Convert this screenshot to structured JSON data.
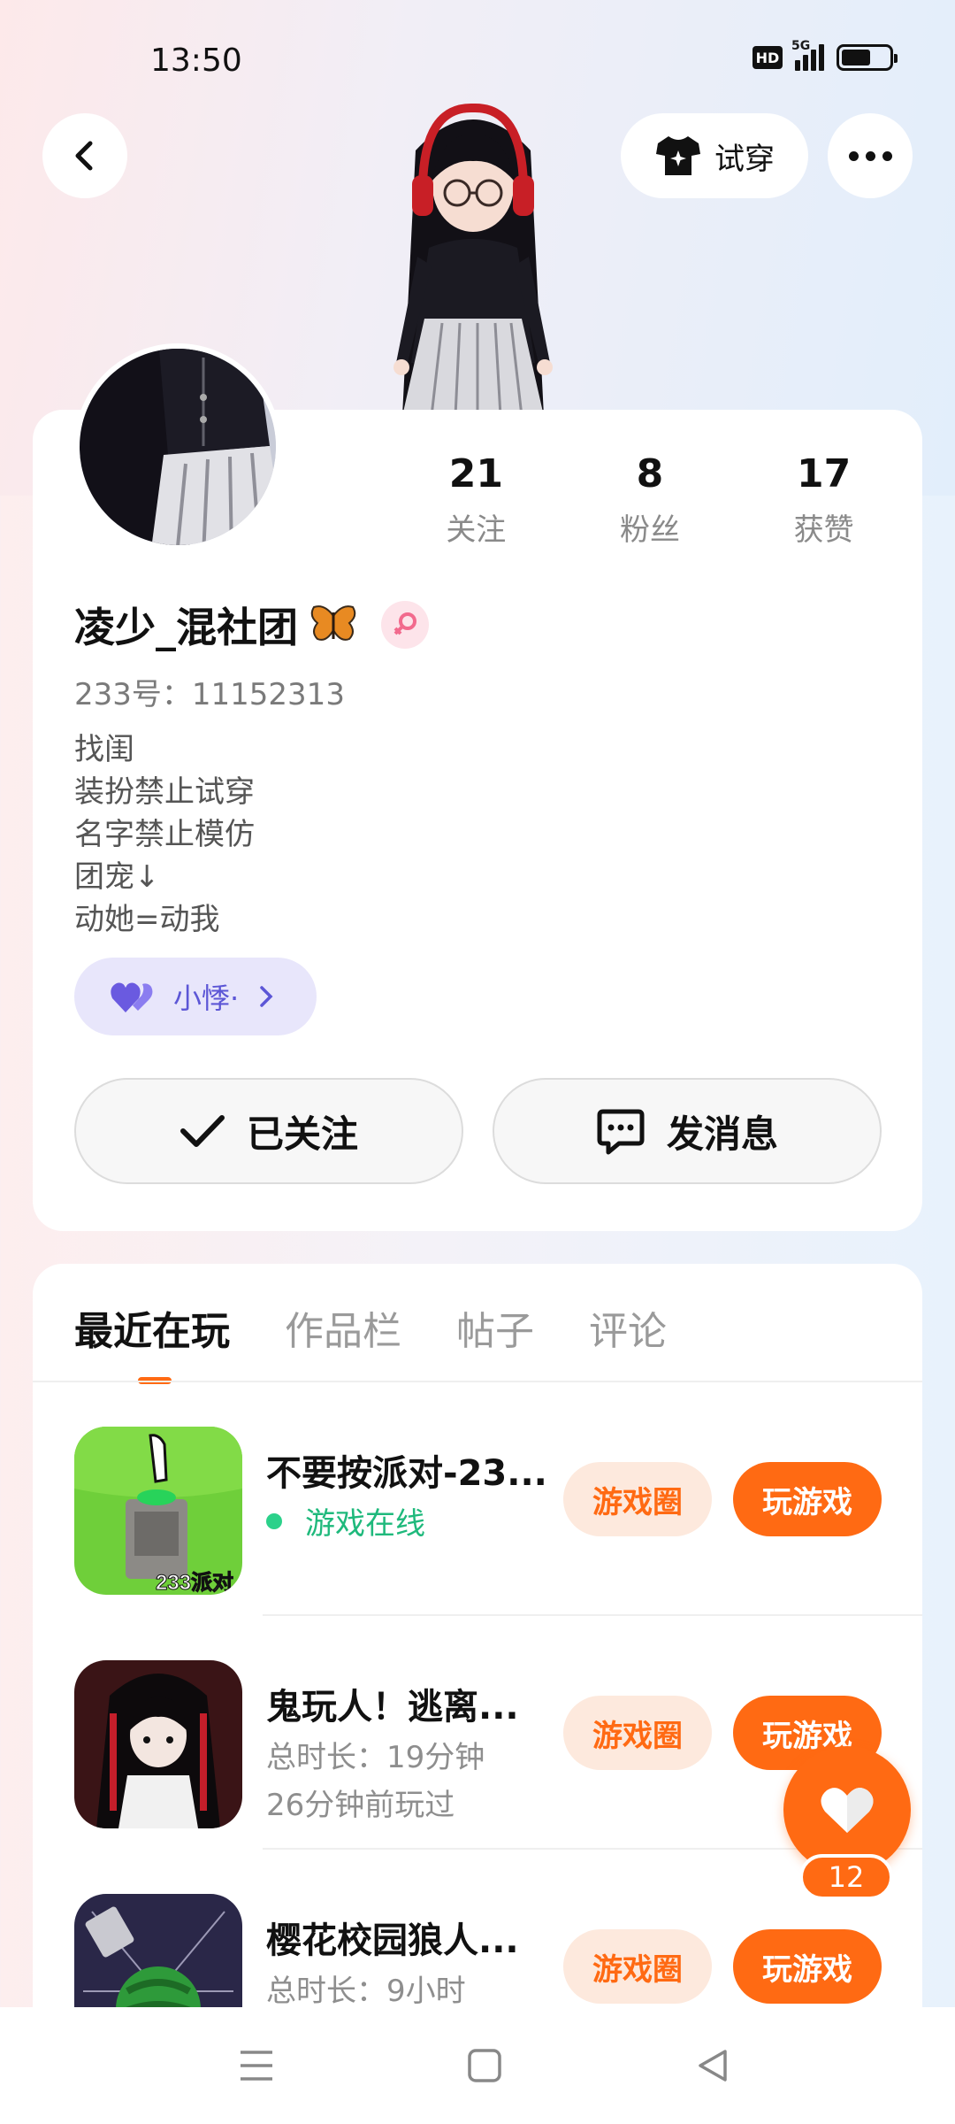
{
  "status_bar": {
    "time": "13:50",
    "hd": "HD",
    "network": "5G"
  },
  "top_bar": {
    "tryon_label": "试穿"
  },
  "profile": {
    "stats": [
      {
        "num": "21",
        "label": "关注"
      },
      {
        "num": "8",
        "label": "粉丝"
      },
      {
        "num": "17",
        "label": "获赞"
      }
    ],
    "username": "凌少_混社团",
    "uid": "233号：11152313",
    "bio": [
      "找闺",
      "装扮禁止试穿",
      "名字禁止模仿",
      "团宠↓",
      "动她=动我"
    ],
    "relation_chip": "小悸·",
    "followed_label": "已关注",
    "message_label": "发消息"
  },
  "tabs": [
    "最近在玩",
    "作品栏",
    "帖子",
    "评论"
  ],
  "games": [
    {
      "title": "不要按派对-23...",
      "status": "游戏在线",
      "circle_label": "游戏圈",
      "play_label": "玩游戏",
      "icon_text": "233派对"
    },
    {
      "title": "鬼玩人！逃离...",
      "line1": "总时长：19分钟",
      "line2": "26分钟前玩过",
      "circle_label": "游戏圈",
      "play_label": "玩游戏"
    },
    {
      "title": "樱花校园狼人...",
      "line1": "总时长：9小时",
      "circle_label": "游戏圈",
      "play_label": "玩游戏"
    }
  ],
  "like": {
    "count": "12"
  },
  "colors": {
    "accent": "#ff6a13",
    "online": "#1fb97c",
    "chip": "#5c56d6"
  }
}
